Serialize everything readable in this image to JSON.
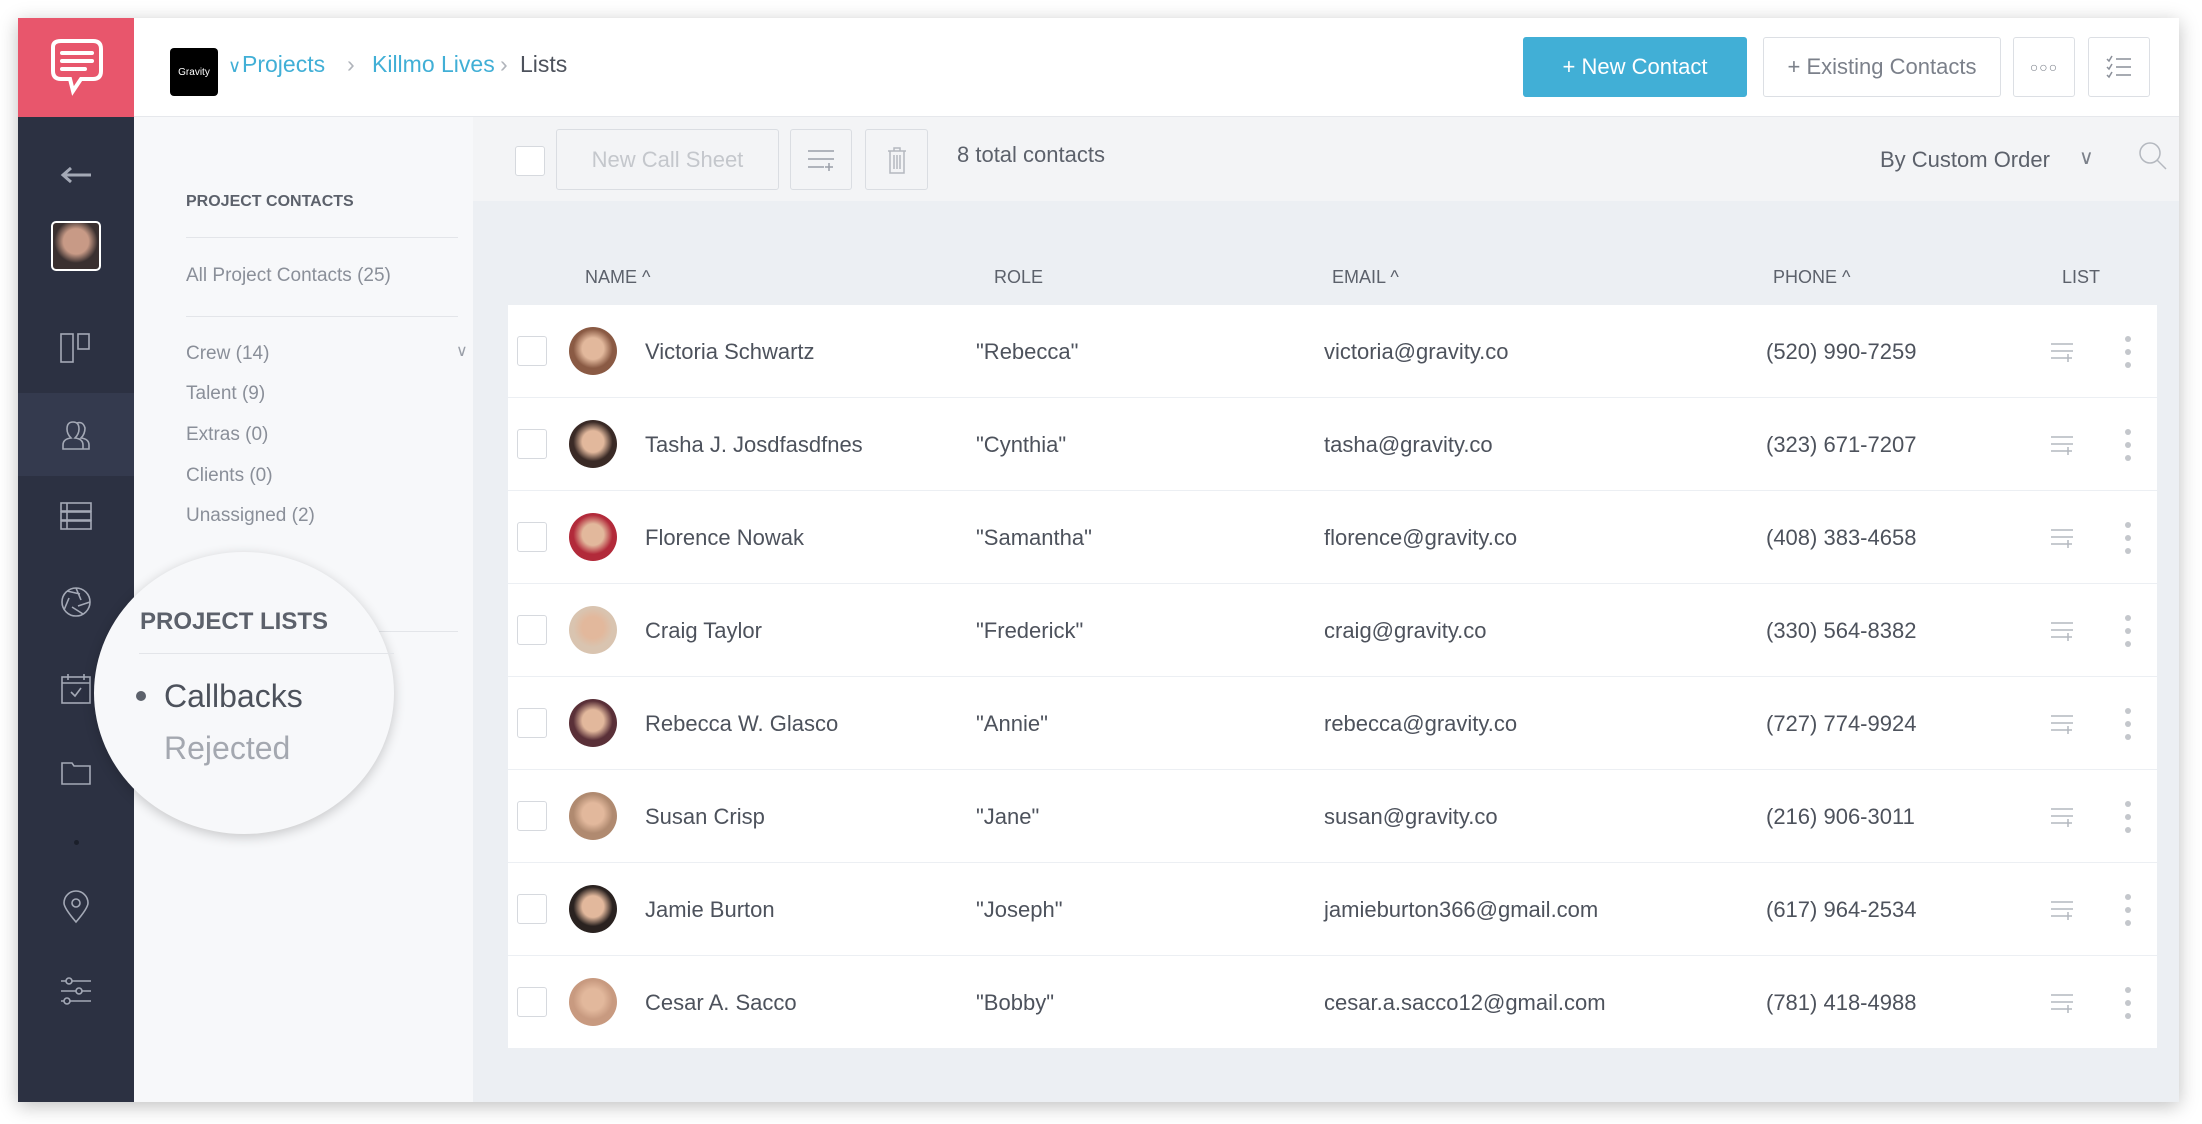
{
  "header": {
    "org_logo_text": "Gravity",
    "breadcrumb": [
      "Projects",
      "Killmo Lives",
      "Lists"
    ],
    "new_contact": "+ New Contact",
    "existing_contacts": "+ Existing Contacts",
    "accent": "#41afd6",
    "brand": "#e8566c"
  },
  "sidebar": {
    "icons": [
      "back-arrow-icon",
      "user-avatar",
      "board-icon",
      "contacts-icon",
      "list-icon",
      "aperture-icon",
      "calendar-icon",
      "folder-icon",
      "location-pin-icon",
      "sliders-icon"
    ],
    "active": "contacts-icon"
  },
  "panel": {
    "contacts_heading": "PROJECT CONTACTS",
    "all": "All Project Contacts (25)",
    "groups": [
      "Crew (14)",
      "Talent (9)",
      "Extras (0)",
      "Clients (0)",
      "Unassigned (2)"
    ],
    "lists_heading": "PROJECT LISTS",
    "lists": [
      "Callbacks",
      "Rejected"
    ],
    "selected_list": "Callbacks"
  },
  "toolbar": {
    "new_call_sheet": "New Call Sheet",
    "total": "8 total contacts",
    "sort": "By Custom Order"
  },
  "table": {
    "columns": {
      "name": "NAME ^",
      "role": "ROLE",
      "email": "EMAIL ^",
      "phone": "PHONE ^",
      "list": "LIST"
    },
    "rows": [
      {
        "name": "Victoria Schwartz",
        "role": "\"Rebecca\"",
        "email": "victoria@gravity.co",
        "phone": "(520) 990-7259"
      },
      {
        "name": "Tasha J. Josdfasdfnes",
        "role": "\"Cynthia\"",
        "email": "tasha@gravity.co",
        "phone": "(323) 671-7207"
      },
      {
        "name": "Florence Nowak",
        "role": "\"Samantha\"",
        "email": "florence@gravity.co",
        "phone": "(408) 383-4658"
      },
      {
        "name": "Craig Taylor",
        "role": "\"Frederick\"",
        "email": "craig@gravity.co",
        "phone": "(330) 564-8382"
      },
      {
        "name": "Rebecca W. Glasco",
        "role": "\"Annie\"",
        "email": "rebecca@gravity.co",
        "phone": "(727) 774-9924"
      },
      {
        "name": "Susan Crisp",
        "role": "\"Jane\"",
        "email": "susan@gravity.co",
        "phone": "(216) 906-3011"
      },
      {
        "name": "Jamie Burton",
        "role": "\"Joseph\"",
        "email": "jamieburton366@gmail.com",
        "phone": "(617) 964-2534"
      },
      {
        "name": "Cesar A. Sacco",
        "role": "\"Bobby\"",
        "email": "cesar.a.sacco12@gmail.com",
        "phone": "(781) 418-4988"
      }
    ]
  }
}
